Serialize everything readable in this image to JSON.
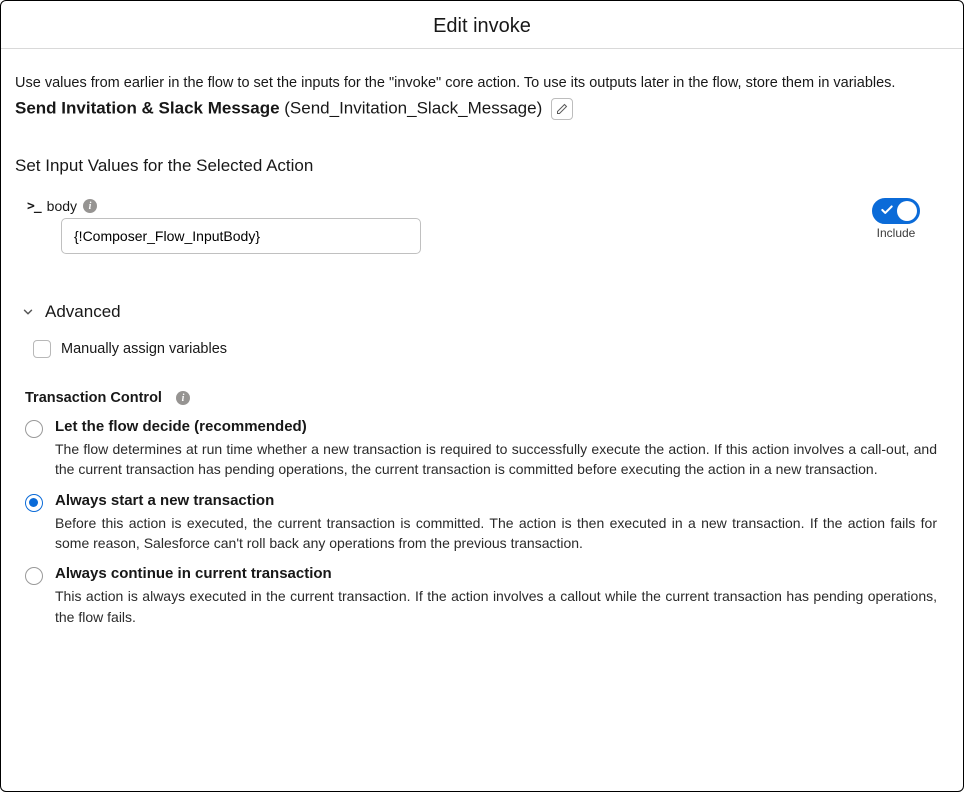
{
  "header": {
    "title": "Edit invoke"
  },
  "intro": "Use values from earlier in the flow to set the inputs for the \"invoke\" core action. To use its outputs later in the flow, store them in variables.",
  "action": {
    "label": "Send Invitation & Slack Message",
    "api": "(Send_Invitation_Slack_Message)"
  },
  "inputsSection": {
    "title": "Set Input Values for the Selected Action",
    "field": {
      "label": "body",
      "value": "{!Composer_Flow_InputBody}"
    },
    "includeLabel": "Include"
  },
  "advanced": {
    "heading": "Advanced",
    "manualAssign": "Manually assign variables",
    "transaction": {
      "heading": "Transaction Control",
      "options": [
        {
          "title": "Let the flow decide (recommended)",
          "desc": "The flow determines at run time whether a new transaction is required to successfully execute the action. If this action involves a call-out, and the current transaction has pending operations, the current transaction is committed before executing the action in a new transaction.",
          "selected": false
        },
        {
          "title": "Always start a new transaction",
          "desc": "Before this action is executed, the current transaction is committed. The action is then executed in a new transaction. If the action fails for some reason, Salesforce can't roll back any operations from the previous transaction.",
          "selected": true
        },
        {
          "title": "Always continue in current transaction",
          "desc": "This action is always executed in the current transaction. If the action involves a callout while the current transaction has pending operations, the flow fails.",
          "selected": false
        }
      ]
    }
  }
}
